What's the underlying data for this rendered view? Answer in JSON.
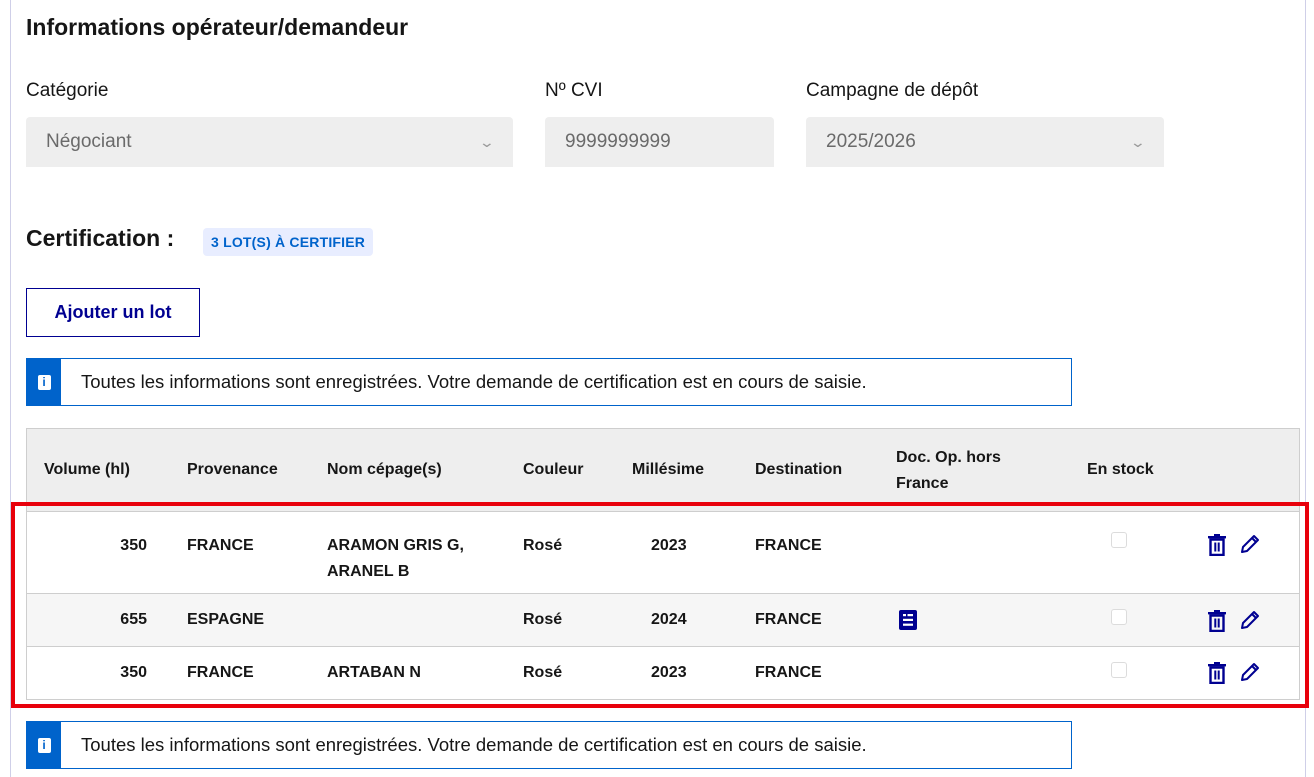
{
  "section": {
    "title": "Informations opérateur/demandeur"
  },
  "fields": {
    "categorie": {
      "label": "Catégorie",
      "value": "Négociant"
    },
    "cvi": {
      "label": "Nº CVI",
      "value": "9999999999"
    },
    "campagne": {
      "label": "Campagne de dépôt",
      "value": "2025/2026"
    }
  },
  "certification": {
    "title": "Certification :",
    "badge": "3 LOT(S) À CERTIFIER"
  },
  "actions": {
    "add_lot": "Ajouter un lot"
  },
  "notice": {
    "icon": "info-icon",
    "text": "Toutes les informations sont enregistrées. Votre demande de certification est en cours de saisie."
  },
  "table": {
    "headers": {
      "volume": "Volume (hl)",
      "provenance": "Provenance",
      "cepage": "Nom cépage(s)",
      "couleur": "Couleur",
      "millesime": "Millésime",
      "destination": "Destination",
      "doc": "Doc. Op. hors France",
      "stock": "En stock"
    },
    "rows": [
      {
        "volume": "350",
        "provenance": "FRANCE",
        "cepage": "ARAMON GRIS G, ARANEL B",
        "couleur": "Rosé",
        "millesime": "2023",
        "destination": "FRANCE",
        "has_doc": false,
        "en_stock": false
      },
      {
        "volume": "655",
        "provenance": "ESPAGNE",
        "cepage": "",
        "couleur": "Rosé",
        "millesime": "2024",
        "destination": "FRANCE",
        "has_doc": true,
        "en_stock": false
      },
      {
        "volume": "350",
        "provenance": "FRANCE",
        "cepage": "ARTABAN N",
        "couleur": "Rosé",
        "millesime": "2023",
        "destination": "FRANCE",
        "has_doc": false,
        "en_stock": false
      }
    ]
  },
  "icons": {
    "delete": "trash-icon",
    "edit": "pencil-icon",
    "document": "document-icon"
  },
  "colors": {
    "primary": "#000091",
    "info": "#0063cb",
    "highlight": "#e8000b"
  }
}
